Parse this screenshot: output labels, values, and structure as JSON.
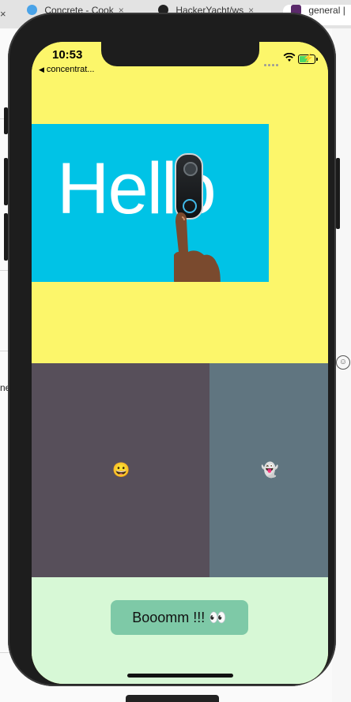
{
  "browser": {
    "tabs": [
      {
        "label": "Concrete - Cook",
        "color": "#4aa3e8"
      },
      {
        "label": "HackerYacht/ws",
        "color": "#222222"
      },
      {
        "label": "general |",
        "color": "#5b2a6b"
      }
    ]
  },
  "background": {
    "partial_text": "ne"
  },
  "status_bar": {
    "time": "10:53",
    "back_label": "concentrat..."
  },
  "hero": {
    "text": "Hello",
    "bg_color": "#00c3e6"
  },
  "sections": {
    "top_color": "#fcf66a",
    "mid_left_color": "#574f5a",
    "mid_right_color": "#607580",
    "bottom_color": "#d7f8d6"
  },
  "emojis": {
    "left": "😀",
    "right": "👻"
  },
  "button": {
    "label": "Booomm !!! 👀",
    "color": "#7ec9a7"
  }
}
